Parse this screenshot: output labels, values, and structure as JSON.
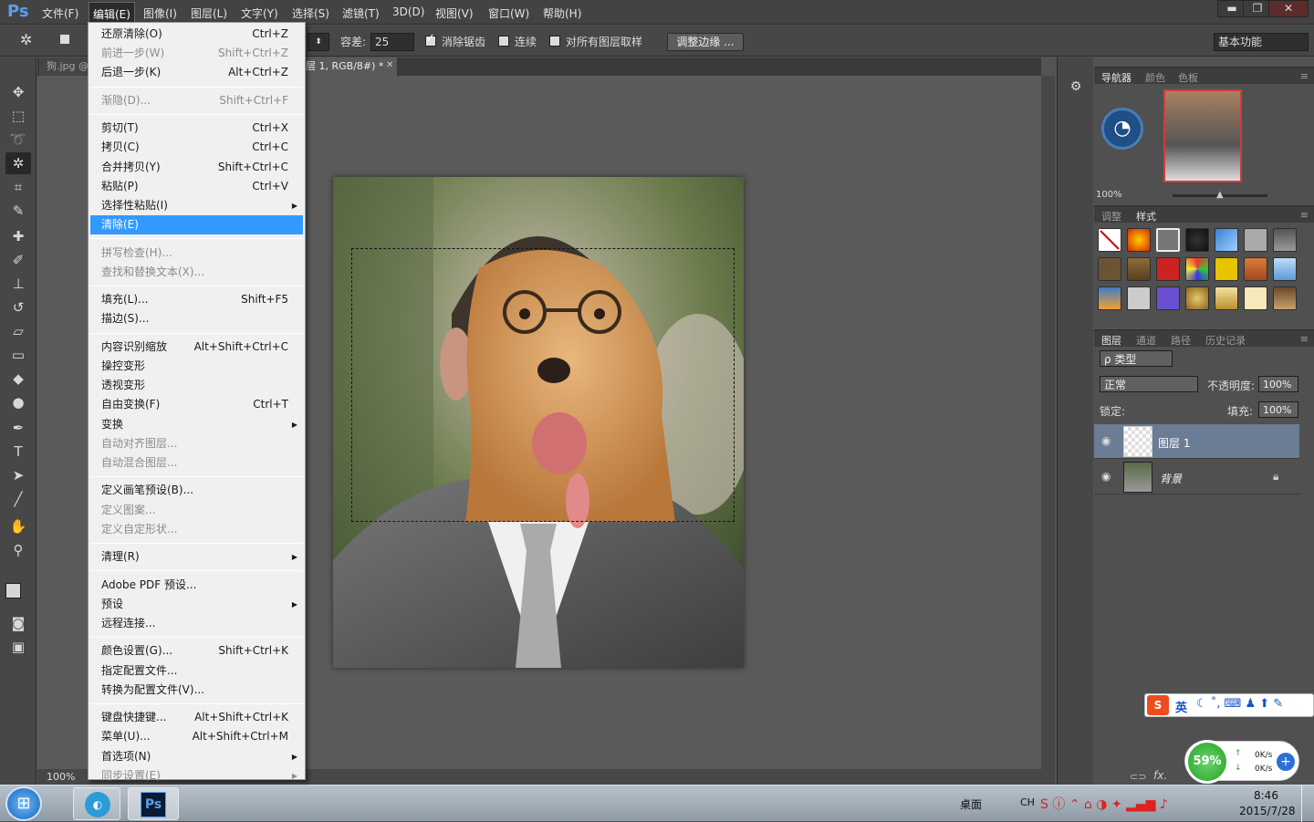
{
  "app": {
    "logo": "Ps"
  },
  "menubar": {
    "items": [
      "文件(F)",
      "编辑(E)",
      "图像(I)",
      "图层(L)",
      "文字(Y)",
      "选择(S)",
      "滤镜(T)",
      "3D(D)",
      "视图(V)",
      "窗口(W)",
      "帮助(H)"
    ],
    "active": "编辑(E)"
  },
  "window_controls": {
    "minimize": "▬",
    "restore": "❐",
    "close": "✕"
  },
  "options": {
    "tolerance_label": "容差:",
    "tolerance_value": "25",
    "antialias_label": "消除锯齿",
    "contiguous_label": "连续",
    "sample_all_label": "对所有图层取样",
    "refine_edge_button": "调整边缘 ...",
    "workspace": "基本功能"
  },
  "document_tabs": [
    {
      "label": "狗.jpg @"
    },
    {
      "label": "层 1, RGB/8#) *"
    }
  ],
  "edit_menu": {
    "items": [
      {
        "label": "还原清除(O)",
        "shortcut": "Ctrl+Z",
        "disabled": false
      },
      {
        "label": "前进一步(W)",
        "shortcut": "Shift+Ctrl+Z",
        "disabled": true
      },
      {
        "label": "后退一步(K)",
        "shortcut": "Alt+Ctrl+Z",
        "disabled": false
      },
      {
        "label": "渐隐(D)...",
        "shortcut": "Shift+Ctrl+F",
        "disabled": true
      },
      {
        "label": "剪切(T)",
        "shortcut": "Ctrl+X",
        "disabled": false
      },
      {
        "label": "拷贝(C)",
        "shortcut": "Ctrl+C",
        "disabled": false
      },
      {
        "label": "合并拷贝(Y)",
        "shortcut": "Shift+Ctrl+C",
        "disabled": false
      },
      {
        "label": "粘贴(P)",
        "shortcut": "Ctrl+V",
        "disabled": false
      },
      {
        "label": "选择性粘贴(I)",
        "shortcut": "",
        "disabled": false,
        "submenu": true
      },
      {
        "label": "清除(E)",
        "shortcut": "",
        "disabled": false,
        "highlighted": true
      },
      {
        "label": "拼写检查(H)...",
        "shortcut": "",
        "disabled": true
      },
      {
        "label": "查找和替换文本(X)...",
        "shortcut": "",
        "disabled": true
      },
      {
        "label": "填充(L)...",
        "shortcut": "Shift+F5",
        "disabled": false
      },
      {
        "label": "描边(S)...",
        "shortcut": "",
        "disabled": false
      },
      {
        "label": "内容识别缩放",
        "shortcut": "Alt+Shift+Ctrl+C",
        "disabled": false
      },
      {
        "label": "操控变形",
        "shortcut": "",
        "disabled": false
      },
      {
        "label": "透视变形",
        "shortcut": "",
        "disabled": false
      },
      {
        "label": "自由变换(F)",
        "shortcut": "Ctrl+T",
        "disabled": false
      },
      {
        "label": "变换",
        "shortcut": "",
        "disabled": false,
        "submenu": true
      },
      {
        "label": "自动对齐图层...",
        "shortcut": "",
        "disabled": true
      },
      {
        "label": "自动混合图层...",
        "shortcut": "",
        "disabled": true
      },
      {
        "label": "定义画笔预设(B)...",
        "shortcut": "",
        "disabled": false
      },
      {
        "label": "定义图案...",
        "shortcut": "",
        "disabled": true
      },
      {
        "label": "定义自定形状...",
        "shortcut": "",
        "disabled": true
      },
      {
        "label": "清理(R)",
        "shortcut": "",
        "disabled": false,
        "submenu": true
      },
      {
        "label": "Adobe PDF 预设...",
        "shortcut": "",
        "disabled": false
      },
      {
        "label": "预设",
        "shortcut": "",
        "disabled": false,
        "submenu": true
      },
      {
        "label": "远程连接...",
        "shortcut": "",
        "disabled": false
      },
      {
        "label": "颜色设置(G)...",
        "shortcut": "Shift+Ctrl+K",
        "disabled": false
      },
      {
        "label": "指定配置文件...",
        "shortcut": "",
        "disabled": false
      },
      {
        "label": "转换为配置文件(V)...",
        "shortcut": "",
        "disabled": false
      },
      {
        "label": "键盘快捷键...",
        "shortcut": "Alt+Shift+Ctrl+K",
        "disabled": false
      },
      {
        "label": "菜单(U)...",
        "shortcut": "Alt+Shift+Ctrl+M",
        "disabled": false
      },
      {
        "label": "首选项(N)",
        "shortcut": "",
        "disabled": false,
        "submenu": true
      },
      {
        "label": "同步设置(E)",
        "shortcut": "",
        "disabled": true,
        "submenu": true
      }
    ],
    "submenu_arrow": "▶"
  },
  "status": {
    "zoom": "100%"
  },
  "navigator": {
    "tabs": [
      "导航器",
      "颜色",
      "色板"
    ],
    "zoom": "100%"
  },
  "styles_panel": {
    "tabs": [
      "调整",
      "样式"
    ]
  },
  "layers_panel": {
    "tabs": [
      "图层",
      "通道",
      "路径",
      "历史记录"
    ],
    "filter_label": "ρ 类型",
    "blend_mode": "正常",
    "opacity_label": "不透明度:",
    "opacity_value": "100%",
    "lock_label": "锁定:",
    "fill_label": "填充:",
    "fill_value": "100%",
    "layers": [
      {
        "name": "图层 1",
        "selected": true
      },
      {
        "name": "背景",
        "selected": false,
        "locked": true
      }
    ],
    "footer_fx": "fx."
  },
  "ime": {
    "lang": "英"
  },
  "netmeter": {
    "percent": "59%",
    "up": "0K/s",
    "down": "0K/s"
  },
  "taskbar": {
    "desktop_label": "桌面",
    "lang": "CH",
    "time": "8:46",
    "date": "2015/7/28",
    "ps_label": "Ps"
  },
  "colors": {
    "highlight": "#3399ff",
    "ps_blue": "#5aa0e6",
    "layer_selected": "#6b7d94"
  }
}
